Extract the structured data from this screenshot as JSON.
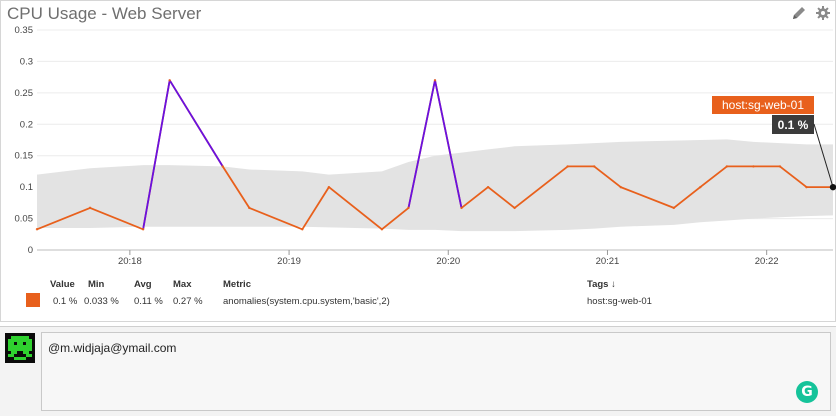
{
  "panel": {
    "title": "CPU Usage - Web Server",
    "edit_icon": "pencil-icon",
    "settings_icon": "gear-icon"
  },
  "chart_data": {
    "type": "line",
    "title": "CPU Usage - Web Server",
    "xlabel": "",
    "ylabel": "",
    "ylim": [
      0,
      0.35
    ],
    "y_ticks": [
      "0",
      "0.05",
      "0.1",
      "0.15",
      "0.2",
      "0.25",
      "0.3",
      "0.35"
    ],
    "x_ticks": [
      "20:18",
      "20:19",
      "20:20",
      "20:21",
      "20:22"
    ],
    "grid": true,
    "series": [
      {
        "name": "anomalies(system.cpu.system,'basic',2)",
        "color": "#e8601c",
        "anomaly_color": "#6a11e0",
        "x": [
          "20:17:25",
          "20:17:45",
          "20:18:05",
          "20:18:15",
          "20:18:35",
          "20:18:45",
          "20:19:05",
          "20:19:15",
          "20:19:35",
          "20:19:45",
          "20:19:55",
          "20:20:05",
          "20:20:15",
          "20:20:25",
          "20:20:45",
          "20:20:55",
          "20:21:05",
          "20:21:25",
          "20:21:35",
          "20:21:45",
          "20:21:55",
          "20:22:05",
          "20:22:15",
          "20:22:25"
        ],
        "values": [
          0.033,
          0.067,
          0.033,
          0.27,
          0.133,
          0.067,
          0.033,
          0.1,
          0.033,
          0.067,
          0.27,
          0.067,
          0.1,
          0.067,
          0.133,
          0.133,
          0.1,
          0.067,
          0.1,
          0.133,
          0.133,
          0.133,
          0.1,
          0.1
        ],
        "anomaly_segments": [
          [
            2,
            4
          ],
          [
            9,
            11
          ]
        ]
      }
    ],
    "band": {
      "color": "#e3e3e3",
      "upper": [
        0.12,
        0.13,
        0.135,
        0.135,
        0.133,
        0.128,
        0.125,
        0.12,
        0.125,
        0.14,
        0.15,
        0.155,
        0.16,
        0.165,
        0.168,
        0.17,
        0.172,
        0.174,
        0.175,
        0.176,
        0.172,
        0.17,
        0.168,
        0.168
      ],
      "lower": [
        0.035,
        0.035,
        0.037,
        0.037,
        0.037,
        0.037,
        0.037,
        0.036,
        0.034,
        0.032,
        0.032,
        0.03,
        0.03,
        0.03,
        0.032,
        0.034,
        0.037,
        0.04,
        0.044,
        0.047,
        0.05,
        0.052,
        0.054,
        0.055
      ]
    },
    "tooltip": {
      "host": "host:sg-web-01",
      "value": "0.1 %"
    }
  },
  "legend": {
    "headers": {
      "value": "Value",
      "min": "Min",
      "avg": "Avg",
      "max": "Max",
      "metric": "Metric",
      "tags": "Tags ↓"
    },
    "row": {
      "value": "0.1 %",
      "min": "0.033 %",
      "avg": "0.11 %",
      "max": "0.27 %",
      "metric": "anomalies(system.cpu.system,'basic',2)",
      "tags": "host:sg-web-01",
      "color": "#e8601c"
    }
  },
  "comment": {
    "avatar_icon": "space-invader-avatar-icon",
    "text": "@m.widjaja@ymail.com",
    "grammarly_icon": "grammarly-icon",
    "grammarly_label": "G"
  }
}
